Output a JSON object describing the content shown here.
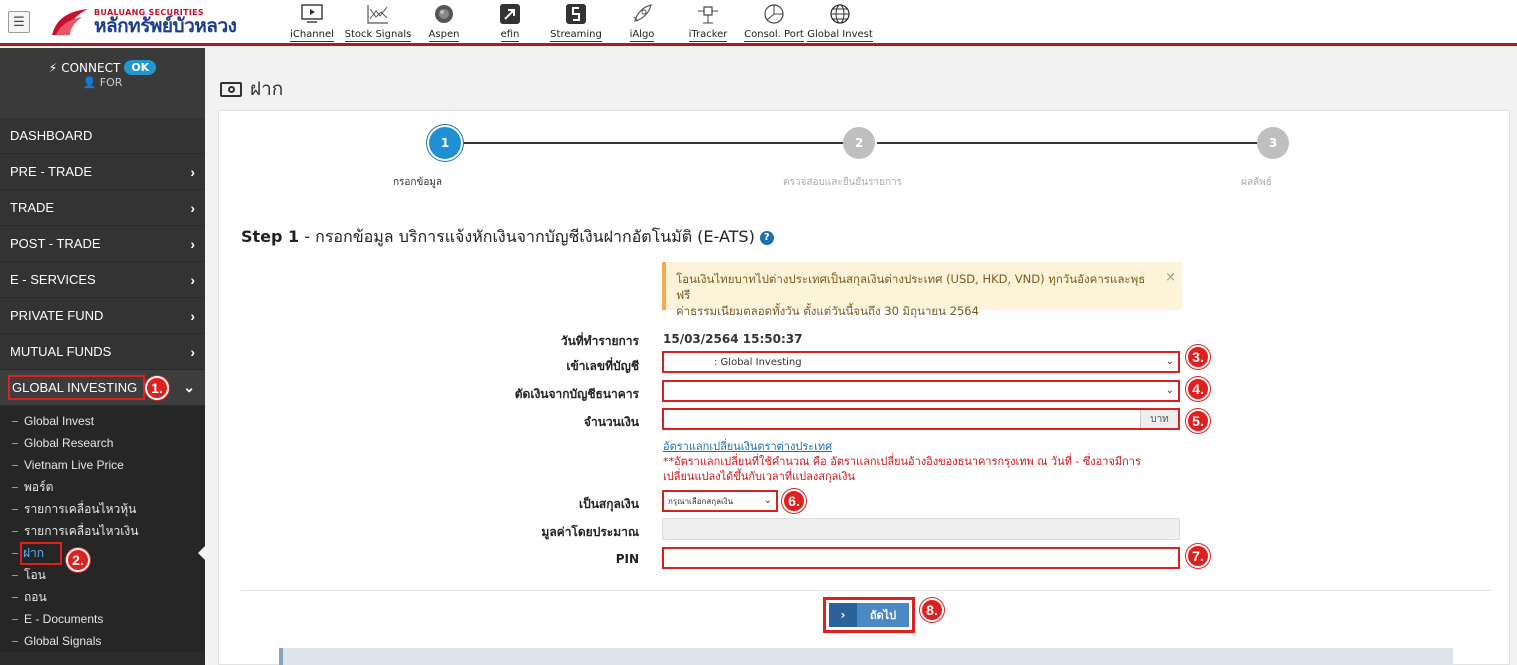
{
  "header": {
    "logo_en": "BUALUANG SECURITIES",
    "logo_th": "หลักทรัพย์บัวหลวง",
    "apps": [
      {
        "label": "iChannel",
        "icon": "monitor-play-icon"
      },
      {
        "label": "Stock Signals",
        "icon": "chart-lines-icon"
      },
      {
        "label": "Aspen",
        "icon": "globe-dark-icon"
      },
      {
        "label": "efin",
        "icon": "efin-icon"
      },
      {
        "label": "Streaming",
        "icon": "streaming-icon"
      },
      {
        "label": "iAlgo",
        "icon": "rocket-icon"
      },
      {
        "label": "iTracker",
        "icon": "satellite-icon"
      },
      {
        "label": "Consol. Port",
        "icon": "pie-icon"
      },
      {
        "label": "Global Invest",
        "icon": "globe-outline-icon"
      }
    ]
  },
  "sidebar": {
    "connect_label": "CONNECT",
    "connect_status": "OK",
    "user": "FOR",
    "items": [
      {
        "label": "DASHBOARD",
        "has_chevron": false
      },
      {
        "label": "PRE - TRADE",
        "has_chevron": true
      },
      {
        "label": "TRADE",
        "has_chevron": true
      },
      {
        "label": "POST - TRADE",
        "has_chevron": true
      },
      {
        "label": "E - SERVICES",
        "has_chevron": true
      },
      {
        "label": "PRIVATE FUND",
        "has_chevron": true
      },
      {
        "label": "MUTUAL FUNDS",
        "has_chevron": true
      },
      {
        "label": "GLOBAL INVESTING",
        "has_chevron": true
      }
    ],
    "subitems": [
      "Global Invest",
      "Global Research",
      "Vietnam Live Price",
      "พอร์ต",
      "รายการเคลื่อนไหวหุ้น",
      "รายการเคลื่อนไหวเงิน",
      "ฝาก",
      "โอน",
      "ถอน",
      "E - Documents",
      "Global Signals"
    ]
  },
  "page": {
    "title": "ฝาก"
  },
  "stepper": {
    "steps": [
      {
        "number": "1",
        "label": "กรอกข้อมูล"
      },
      {
        "number": "2",
        "label": "ตรวจสอบและยืนยันรายการ"
      },
      {
        "number": "3",
        "label": "ผลลัพธ์"
      }
    ]
  },
  "step_heading": {
    "bold": "Step 1",
    "text": " - กรอกข้อมูล บริการแจ้งหักเงินจากบัญชีเงินฝากอัตโนมัติ (E-ATS)"
  },
  "notice": {
    "line1": "โอนเงินไทยบาทไปต่างประเทศเป็นสกุลเงินต่างประเทศ (USD, HKD, VND) ทุกวันอังคารและพุธ ฟรี",
    "line2": "ค่าธรรมเนียมตลอดทั้งวัน ตั้งแต่วันนี้จนถึง 30 มิถุนายน 2564"
  },
  "form": {
    "date_label": "วันที่ทำรายการ",
    "date_value": "15/03/2564 15:50:37",
    "account_label": "เข้าเลขที่บัญชี",
    "account_value": ": Global Investing",
    "bank_label": "ตัดเงินจากบัญชีธนาคาร",
    "bank_value": "",
    "amount_label": "จำนวนเงิน",
    "amount_value": "",
    "amount_unit": "บาท",
    "fx_link": "อัตราแลกเปลี่ยนเงินตราต่างประเทศ",
    "fx_warning_1": "**อัตราแลกเปลี่ยนที่ใช้คำนวณ คือ อัตราแลกเปลี่ยนอ้างอิงของธนาคารกรุงเทพ ณ วันที่ - ซึ่งอาจมีการ",
    "fx_warning_2": "เปลี่ยนแปลงได้ขึ้นกับเวลาที่แปลงสกุลเงิน",
    "currency_label": "เป็นสกุลเงิน",
    "currency_value": "กรุณาเลือกสกุลเงิน",
    "estimate_label": "มูลค่าโดยประมาณ",
    "pin_label": "PIN",
    "next_button": "ถัดไป"
  },
  "markers": [
    "1.",
    "2.",
    "3.",
    "4.",
    "5.",
    "6.",
    "7.",
    "8."
  ],
  "colors": {
    "brand_red": "#b0171f",
    "highlight_red": "#e0201f",
    "active_step": "#1f8fd6",
    "button_blue": "#4a89c4"
  }
}
